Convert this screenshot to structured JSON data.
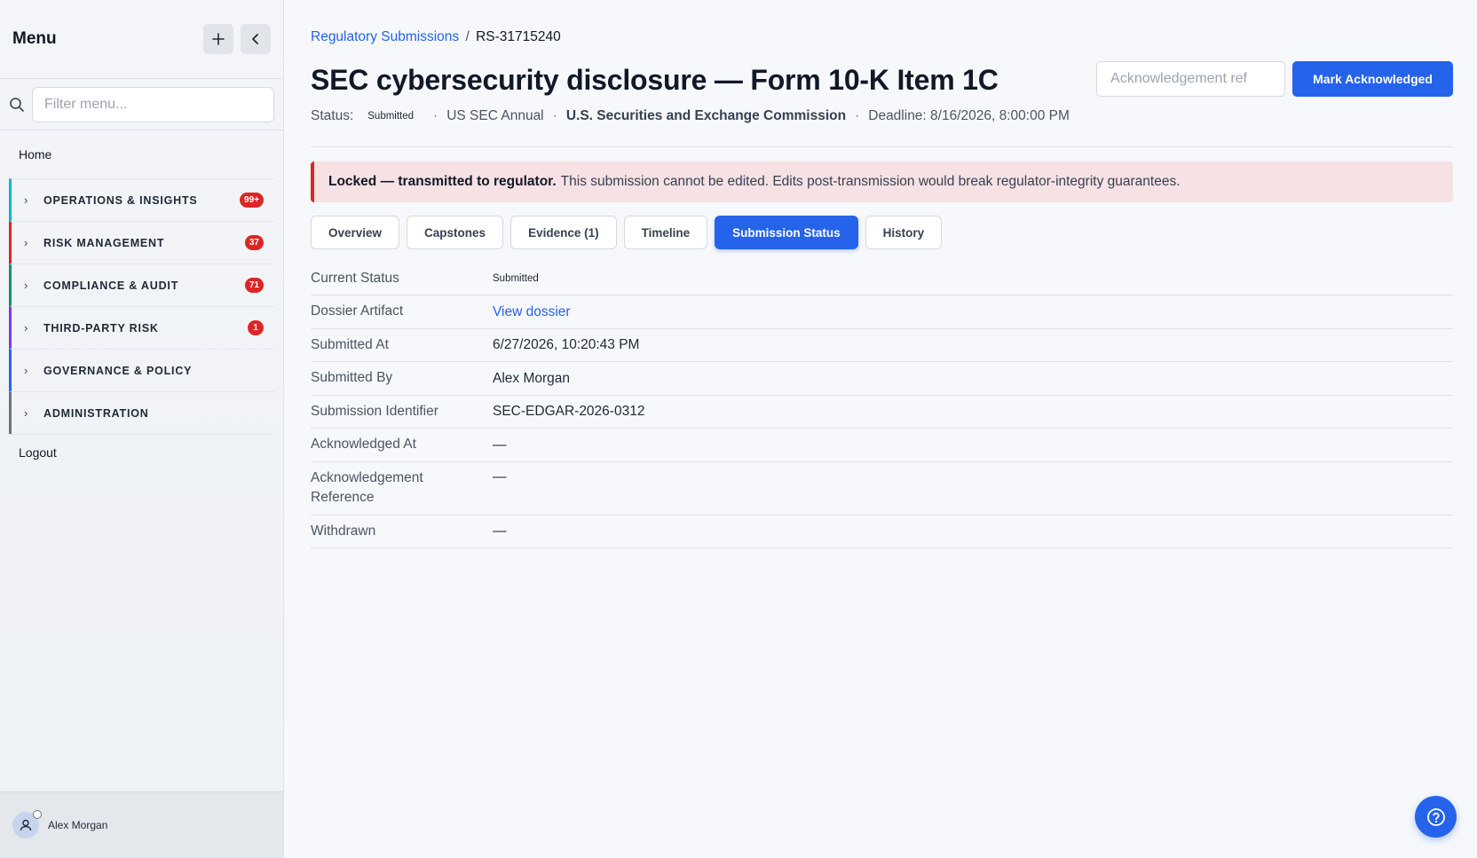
{
  "sidebar": {
    "title": "Menu",
    "filter_placeholder": "Filter menu...",
    "home": "Home",
    "groups": [
      {
        "label": "OPERATIONS & INSIGHTS",
        "badge": "99+",
        "color": "#06b6d4"
      },
      {
        "label": "RISK MANAGEMENT",
        "badge": "37",
        "color": "#dc2626"
      },
      {
        "label": "COMPLIANCE & AUDIT",
        "badge": "71",
        "color": "#059669"
      },
      {
        "label": "THIRD-PARTY RISK",
        "badge": "1",
        "color": "#7c3aed"
      },
      {
        "label": "GOVERNANCE & POLICY",
        "badge": "",
        "color": "#2563eb"
      },
      {
        "label": "ADMINISTRATION",
        "badge": "",
        "color": "#6b7280"
      }
    ],
    "logout": "Logout",
    "user_name": "Alex Morgan"
  },
  "breadcrumb": {
    "parent": "Regulatory Submissions",
    "separator": "/",
    "current": "RS-31715240"
  },
  "page": {
    "title": "SEC cybersecurity disclosure — Form 10-K Item 1C",
    "status_label": "Status:",
    "status_value": "Submitted",
    "cadence": "US SEC Annual",
    "regulator": "U.S. Securities and Exchange Commission",
    "deadline": "Deadline: 8/16/2026, 8:00:00 PM"
  },
  "actions": {
    "ack_placeholder": "Acknowledgement ref",
    "mark_ack_label": "Mark Acknowledged"
  },
  "alert": {
    "bold": "Locked — transmitted to regulator.",
    "text": "This submission cannot be edited. Edits post-transmission would break regulator-integrity guarantees."
  },
  "tabs": [
    {
      "label": "Overview",
      "active": false
    },
    {
      "label": "Capstones",
      "active": false
    },
    {
      "label": "Evidence (1)",
      "active": false
    },
    {
      "label": "Timeline",
      "active": false
    },
    {
      "label": "Submission Status",
      "active": true
    },
    {
      "label": "History",
      "active": false
    }
  ],
  "details": {
    "current_status": {
      "key": "Current Status",
      "value": "Submitted"
    },
    "dossier": {
      "key": "Dossier Artifact",
      "value": "View dossier"
    },
    "submitted_at": {
      "key": "Submitted At",
      "value": "6/27/2026, 10:20:43 PM"
    },
    "submitted_by": {
      "key": "Submitted By",
      "value": "Alex Morgan"
    },
    "identifier": {
      "key": "Submission Identifier",
      "value": "SEC-EDGAR-2026-0312"
    },
    "ack_at": {
      "key": "Acknowledged At",
      "value": "—"
    },
    "ack_ref": {
      "key": "Acknowledgement Reference",
      "value": "—"
    },
    "withdrawn": {
      "key": "Withdrawn",
      "value": "—"
    }
  }
}
